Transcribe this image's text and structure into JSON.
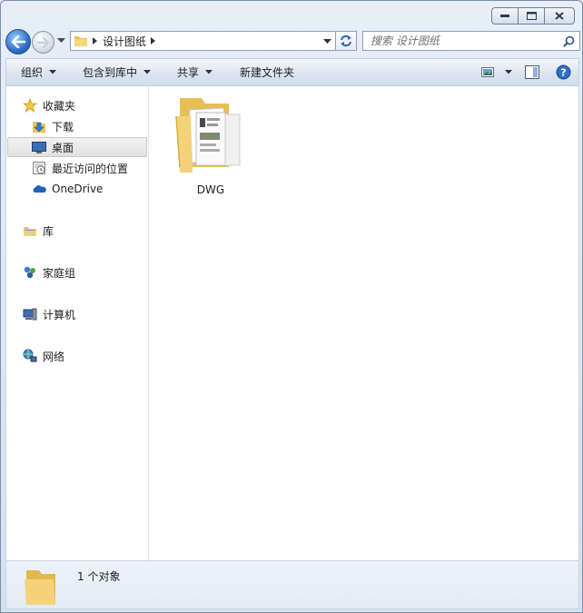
{
  "window": {
    "caption_buttons": [
      "minimize",
      "maximize",
      "close"
    ]
  },
  "address": {
    "breadcrumb": [
      "设计图纸"
    ],
    "search_placeholder": "搜索 设计图纸"
  },
  "command_bar": {
    "organize": "组织",
    "include_in_library": "包含到库中",
    "share": "共享",
    "new_folder": "新建文件夹"
  },
  "nav_pane": {
    "favorites": {
      "label": "收藏夹",
      "items": [
        {
          "label": "下载",
          "icon": "download-folder-icon"
        },
        {
          "label": "桌面",
          "icon": "desktop-icon",
          "selected": true
        },
        {
          "label": "最近访问的位置",
          "icon": "recent-places-icon"
        },
        {
          "label": "OneDrive",
          "icon": "onedrive-icon"
        }
      ]
    },
    "libraries": {
      "label": "库"
    },
    "homegroup": {
      "label": "家庭组"
    },
    "computer": {
      "label": "计算机"
    },
    "network": {
      "label": "网络"
    }
  },
  "files": [
    {
      "name": "DWG",
      "type": "folder"
    }
  ],
  "details": {
    "count_text": "1 个对象"
  },
  "colors": {
    "selection_bg": "#e3e3e3",
    "window_frame": "#d6e1ef",
    "accent_blue": "#2f6fc4"
  }
}
